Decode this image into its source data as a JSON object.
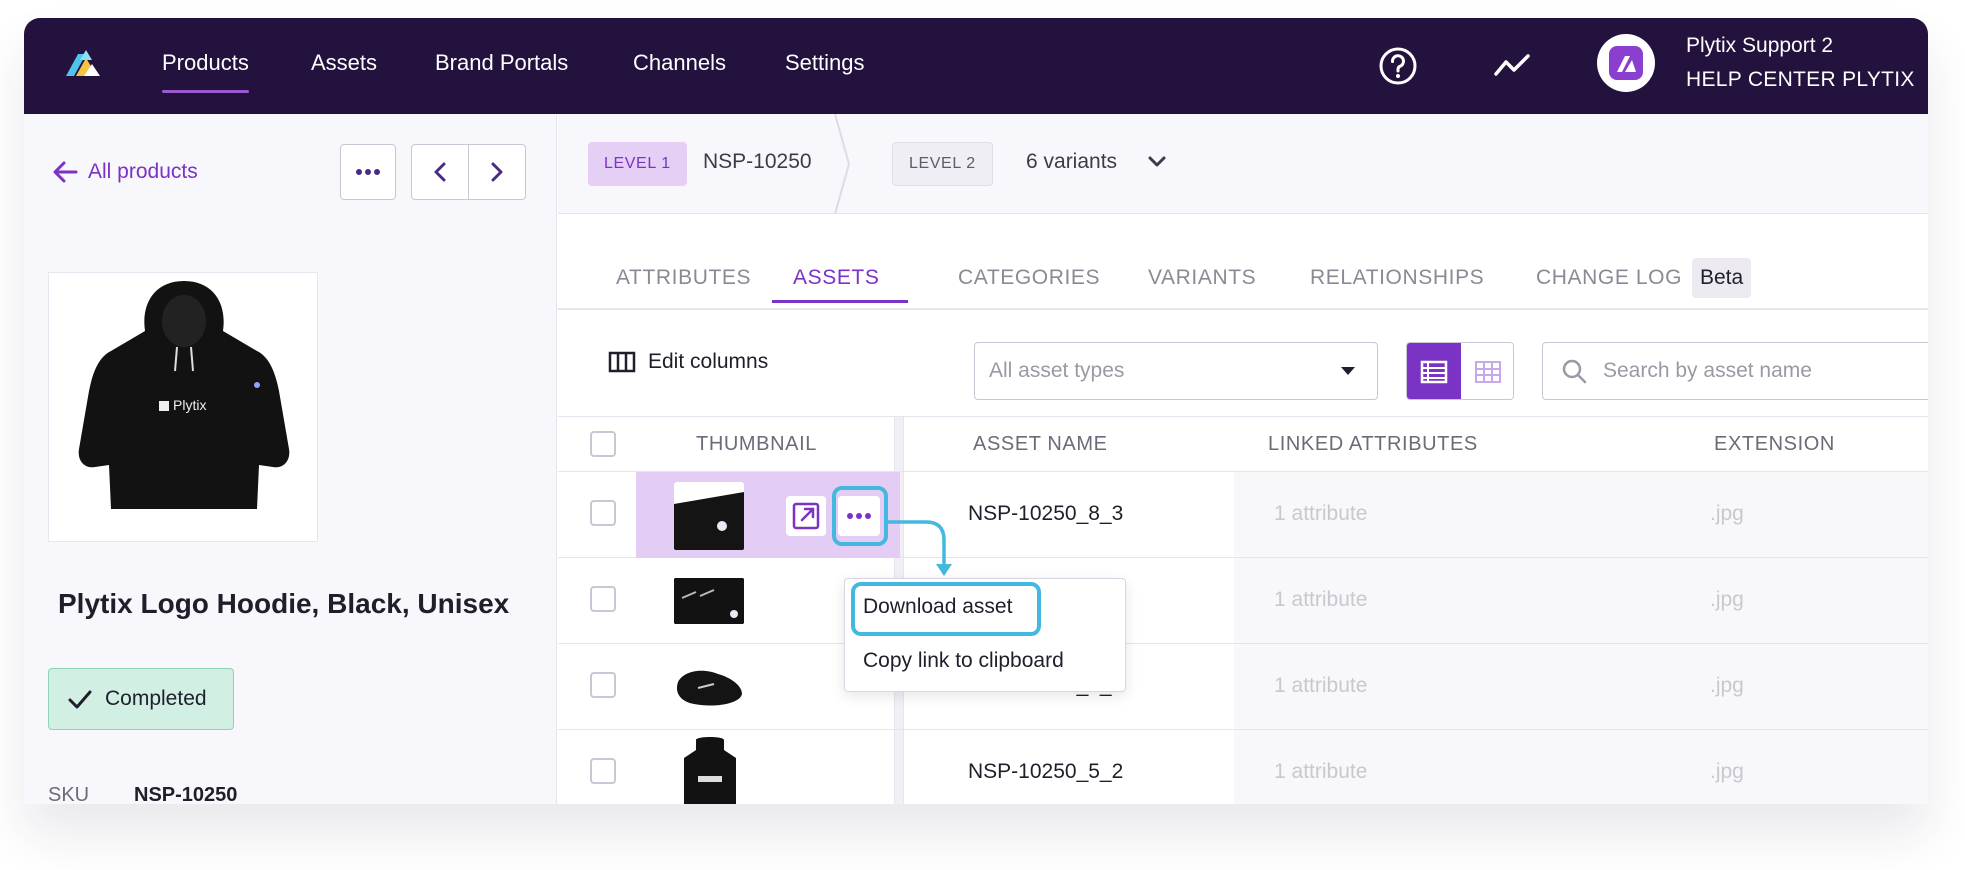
{
  "nav": {
    "items": [
      "Products",
      "Assets",
      "Brand Portals",
      "Channels",
      "Settings"
    ],
    "active": "Products"
  },
  "user": {
    "name": "Plytix Support 2",
    "org": "HELP CENTER PLYTIX"
  },
  "left": {
    "back_label": "All products",
    "product_title": "Plytix Logo Hoodie, Black, Unisex",
    "status": "Completed",
    "sku_label": "SKU",
    "sku_value": "NSP-10250",
    "hoodie_logo_text": "Plytix"
  },
  "levels": {
    "level1_badge": "LEVEL 1",
    "level1_value": "NSP-10250",
    "level2_badge": "LEVEL 2",
    "level2_value": "6 variants"
  },
  "tabs": [
    "ATTRIBUTES",
    "ASSETS",
    "CATEGORIES",
    "VARIANTS",
    "RELATIONSHIPS",
    "CHANGE LOG"
  ],
  "active_tab": "ASSETS",
  "beta_label": "Beta",
  "toolbar": {
    "edit_columns": "Edit columns",
    "asset_type_placeholder": "All asset types",
    "search_placeholder": "Search by asset name"
  },
  "table": {
    "headers": {
      "thumbnail": "THUMBNAIL",
      "asset_name": "ASSET NAME",
      "linked_attributes": "LINKED ATTRIBUTES",
      "extension": "EXTENSION"
    },
    "rows": [
      {
        "name": "NSP-10250_8_3",
        "attributes": "1 attribute",
        "extension": ".jpg"
      },
      {
        "name": "",
        "attributes": "1 attribute",
        "extension": ".jpg"
      },
      {
        "name": "NSP-10250_6_3",
        "attributes": "1 attribute",
        "extension": ".jpg"
      },
      {
        "name": "NSP-10250_5_2",
        "attributes": "1 attribute",
        "extension": ".jpg"
      }
    ]
  },
  "menu": {
    "download": "Download asset",
    "copy_link": "Copy link to clipboard"
  },
  "colors": {
    "nav_bg": "#22123d",
    "accent": "#7a33c4",
    "callout": "#44b8de",
    "status_bg": "#d2efe3"
  }
}
